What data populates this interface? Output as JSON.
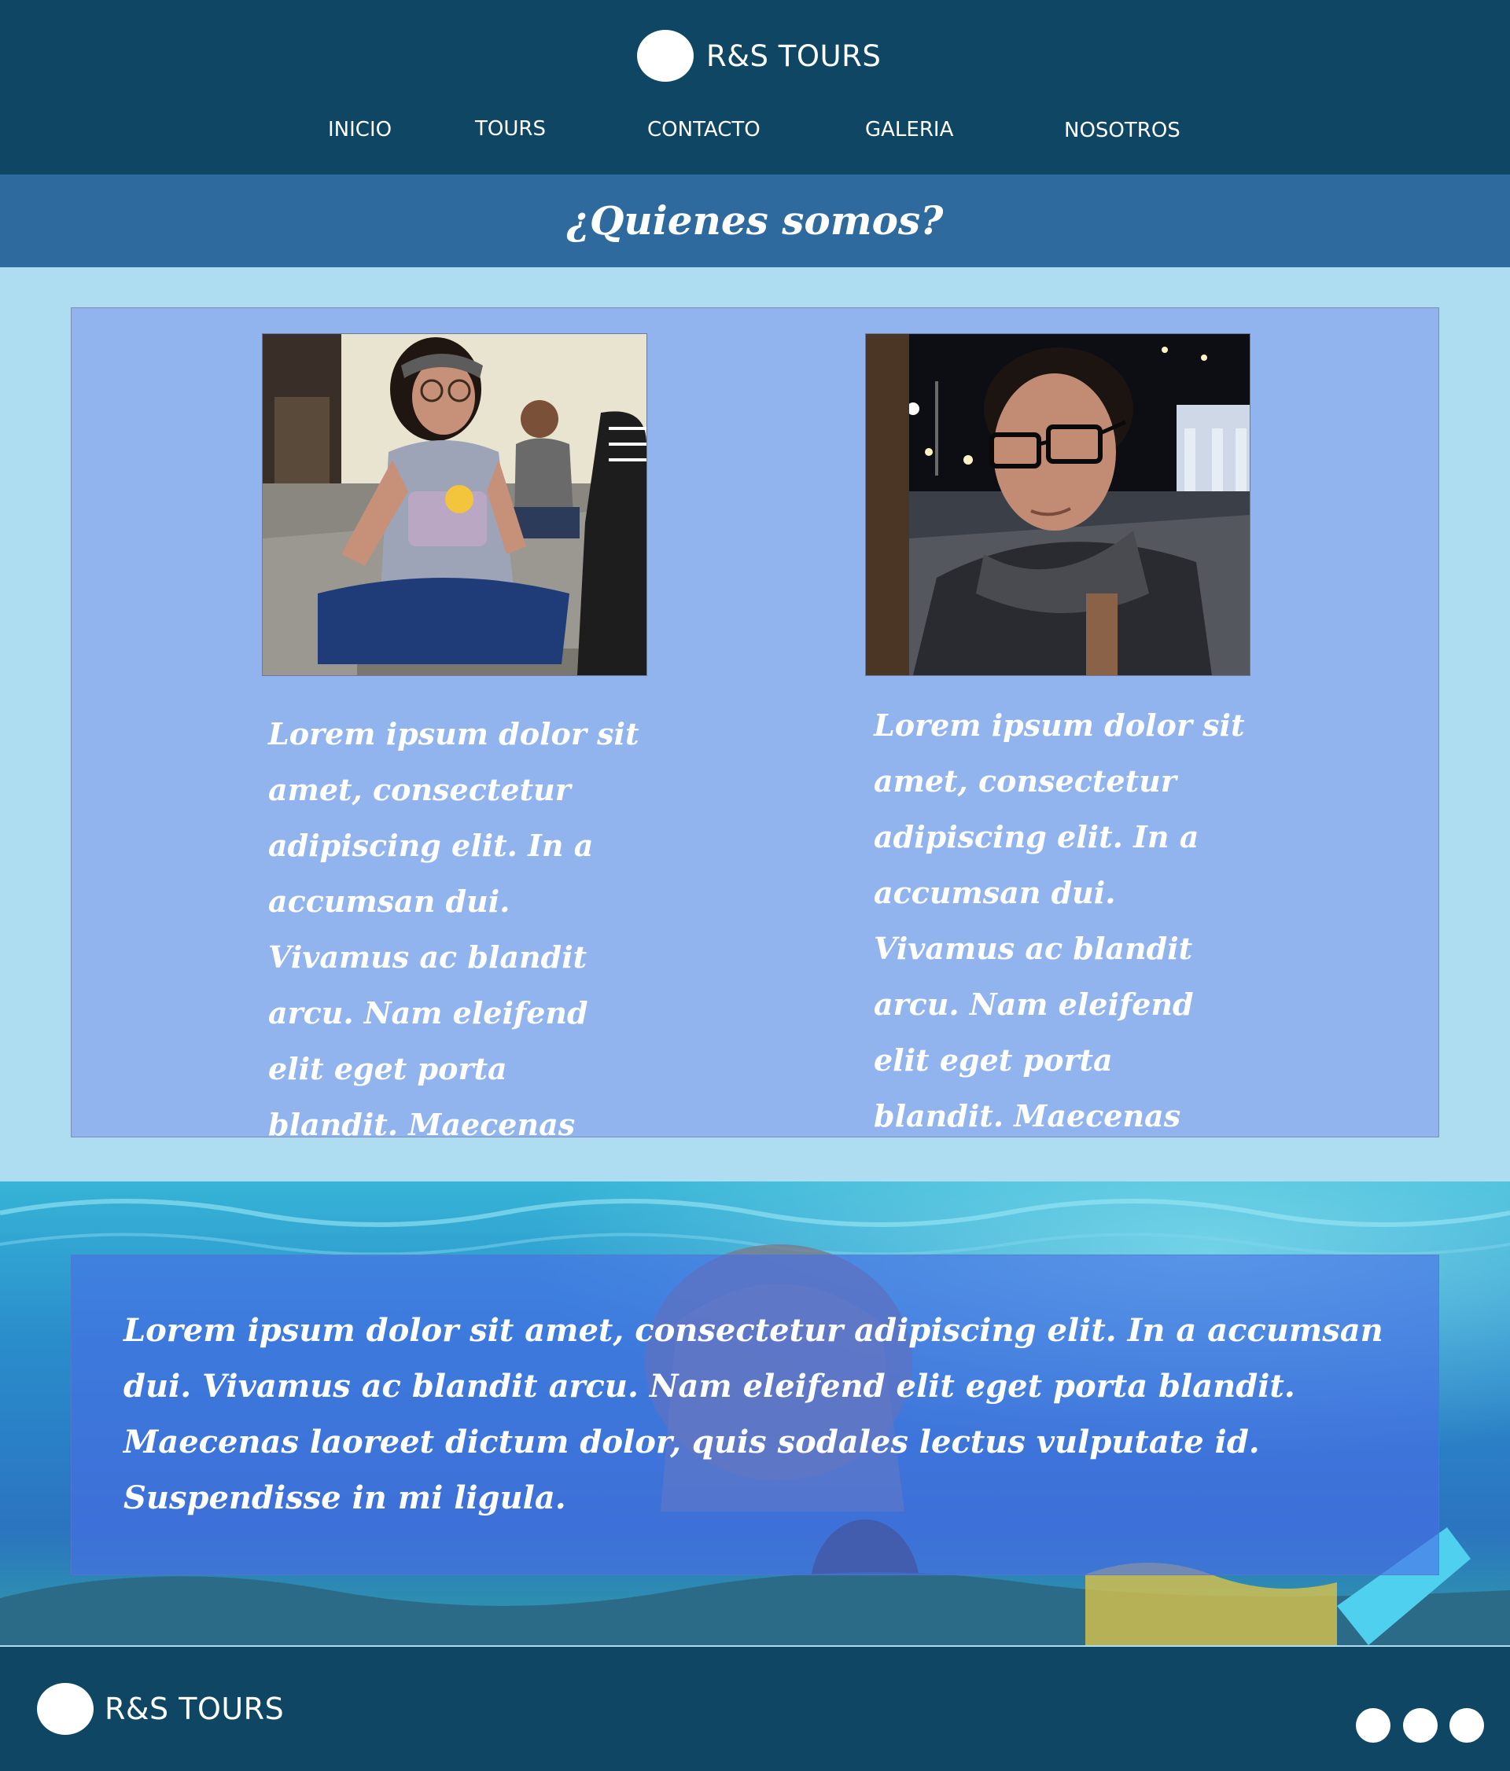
{
  "header": {
    "brand": "R&S TOURS",
    "nav": [
      "INICIO",
      "TOURS",
      "CONTACTO",
      "GALERIA",
      "NOSOTROS"
    ]
  },
  "section": {
    "title": "¿Quienes somos?"
  },
  "team": {
    "members": [
      {
        "bio": "Lorem ipsum dolor sit amet, consectetur adipiscing elit. In a accumsan dui. Vivamus ac blandit arcu. Nam eleifend elit eget porta blandit. Maecenas"
      },
      {
        "bio": "Lorem ipsum dolor sit amet, consectetur adipiscing elit. In a accumsan dui. Vivamus ac blandit arcu. Nam eleifend elit eget porta blandit. Maecenas"
      }
    ]
  },
  "banner": {
    "text": "Lorem ipsum dolor sit amet, consectetur adipiscing elit. In a accumsan dui. Vivamus ac blandit arcu. Nam eleifend elit eget porta blandit. Maecenas laoreet dictum dolor, quis sodales lectus vulputate id. Suspendisse in mi ligula."
  },
  "footer": {
    "brand": "R&S TOURS",
    "social_icons": [
      "social-icon-1",
      "social-icon-2",
      "social-icon-3"
    ]
  },
  "colors": {
    "header_bg": "#0e4664",
    "title_bar_bg": "#2e6a9e",
    "page_bg": "#aedcf0",
    "card_bg": "#92b4ee",
    "text": "#ffffff"
  }
}
